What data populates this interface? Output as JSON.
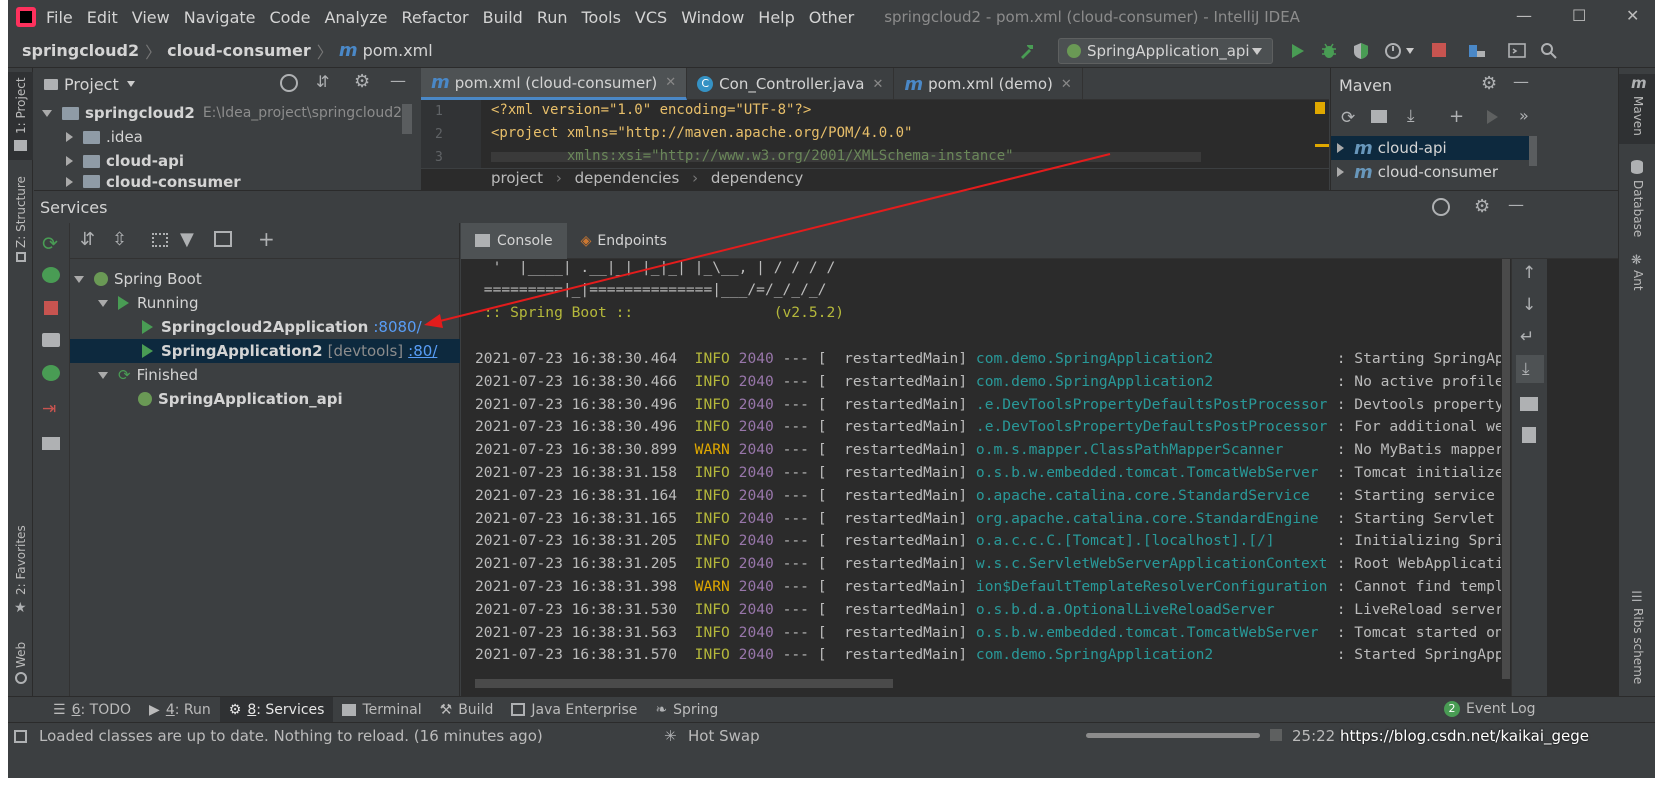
{
  "window": {
    "menu": [
      "File",
      "Edit",
      "View",
      "Navigate",
      "Code",
      "Analyze",
      "Refactor",
      "Build",
      "Run",
      "Tools",
      "VCS",
      "Window",
      "Help",
      "Other"
    ],
    "title": "springcloud2 - pom.xml (cloud-consumer) - IntelliJ IDEA"
  },
  "navbar": {
    "crumbs": [
      "springcloud2",
      "cloud-consumer",
      "pom.xml"
    ],
    "run_config": "SpringApplication_api"
  },
  "left_stripe": {
    "project": "1: Project",
    "structure": "Z: Structure",
    "favorites": "2: Favorites",
    "web": "Web"
  },
  "right_stripe": {
    "maven": "Maven",
    "database": "Database",
    "ant": "Ant",
    "ribs": "Ribs scheme"
  },
  "project": {
    "title": "Project",
    "root_name": "springcloud2",
    "root_path": "E:\\Idea_project\\springcloud2",
    "items": [
      ".idea",
      "cloud-api",
      "cloud-consumer"
    ]
  },
  "editor": {
    "tabs": [
      "pom.xml (cloud-consumer)",
      "Con_Controller.java",
      "pom.xml (demo)"
    ],
    "line_numbers": [
      "1",
      "2",
      "3"
    ],
    "lines": [
      "<?xml version=\"1.0\" encoding=\"UTF-8\"?>",
      "<project xmlns=\"http://maven.apache.org/POM/4.0.0\"",
      "         xmlns:xsi=\"http://www.w3.org/2001/XMLSchema-instance\""
    ],
    "breadcrumbs": [
      "project",
      "dependencies",
      "dependency"
    ]
  },
  "maven": {
    "title": "Maven",
    "items": [
      "cloud-api",
      "cloud-consumer"
    ]
  },
  "services": {
    "title": "Services",
    "tree": {
      "spring_boot": "Spring Boot",
      "running": "Running",
      "app1": "Springcloud2Application",
      "app1_port": ":8080/",
      "app2": "SpringApplication2",
      "app2_devtools": "[devtools]",
      "app2_port": ":80/",
      "finished": "Finished",
      "app3": "SpringApplication_api"
    },
    "console_tabs": [
      "Console",
      "Endpoints"
    ],
    "banner": [
      "  '  |____| .__|_| |_|_| |_\\__, | / / / /",
      " =========|_|==============|___/=/_/_/_/",
      " :: Spring Boot ::                (v2.5.2)"
    ],
    "log": [
      {
        "ts": "2021-07-23 16:38:30.464",
        "level": "INFO",
        "pid": "2040",
        "thread": "restartedMain",
        "logger": "com.demo.SpringApplication2",
        "msg": "Starting SpringApplic"
      },
      {
        "ts": "2021-07-23 16:38:30.466",
        "level": "INFO",
        "pid": "2040",
        "thread": "restartedMain",
        "logger": "com.demo.SpringApplication2",
        "msg": "No active profile set"
      },
      {
        "ts": "2021-07-23 16:38:30.496",
        "level": "INFO",
        "pid": "2040",
        "thread": "restartedMain",
        "logger": ".e.DevToolsPropertyDefaultsPostProcessor",
        "msg": "Devtools property de"
      },
      {
        "ts": "2021-07-23 16:38:30.496",
        "level": "INFO",
        "pid": "2040",
        "thread": "restartedMain",
        "logger": ".e.DevToolsPropertyDefaultsPostProcessor",
        "msg": "For additional web re"
      },
      {
        "ts": "2021-07-23 16:38:30.899",
        "level": "WARN",
        "pid": "2040",
        "thread": "restartedMain",
        "logger": "o.m.s.mapper.ClassPathMapperScanner",
        "msg": "No MyBatis mapper was"
      },
      {
        "ts": "2021-07-23 16:38:31.158",
        "level": "INFO",
        "pid": "2040",
        "thread": "restartedMain",
        "logger": "o.s.b.w.embedded.tomcat.TomcatWebServer",
        "msg": "Tomcat initialized wi"
      },
      {
        "ts": "2021-07-23 16:38:31.164",
        "level": "INFO",
        "pid": "2040",
        "thread": "restartedMain",
        "logger": "o.apache.catalina.core.StandardService",
        "msg": "Starting service [Tom"
      },
      {
        "ts": "2021-07-23 16:38:31.165",
        "level": "INFO",
        "pid": "2040",
        "thread": "restartedMain",
        "logger": "org.apache.catalina.core.StandardEngine",
        "msg": "Starting Servlet engi"
      },
      {
        "ts": "2021-07-23 16:38:31.205",
        "level": "INFO",
        "pid": "2040",
        "thread": "restartedMain",
        "logger": "o.a.c.c.C.[Tomcat].[localhost].[/]",
        "msg": "Initializing Spring e"
      },
      {
        "ts": "2021-07-23 16:38:31.205",
        "level": "INFO",
        "pid": "2040",
        "thread": "restartedMain",
        "logger": "w.s.c.ServletWebServerApplicationContext",
        "msg": "Root WebApplicationCo"
      },
      {
        "ts": "2021-07-23 16:38:31.398",
        "level": "WARN",
        "pid": "2040",
        "thread": "restartedMain",
        "logger": "ion$DefaultTemplateResolverConfiguration",
        "msg": "Cannot find template"
      },
      {
        "ts": "2021-07-23 16:38:31.530",
        "level": "INFO",
        "pid": "2040",
        "thread": "restartedMain",
        "logger": "o.s.b.d.a.OptionalLiveReloadServer",
        "msg": "LiveReload server is"
      },
      {
        "ts": "2021-07-23 16:38:31.563",
        "level": "INFO",
        "pid": "2040",
        "thread": "restartedMain",
        "logger": "o.s.b.w.embedded.tomcat.TomcatWebServer",
        "msg": "Tomcat started on por"
      },
      {
        "ts": "2021-07-23 16:38:31.570",
        "level": "INFO",
        "pid": "2040",
        "thread": "restartedMain",
        "logger": "com.demo.SpringApplication2",
        "msg": "Started SpringApplica"
      }
    ]
  },
  "bottom_tabs": [
    {
      "num": "6",
      "label": "TODO"
    },
    {
      "num": "4",
      "label": "Run"
    },
    {
      "num": "8",
      "label": "Services"
    },
    {
      "num": "",
      "label": "Terminal"
    },
    {
      "num": "",
      "label": "Build"
    },
    {
      "num": "",
      "label": "Java Enterprise"
    },
    {
      "num": "",
      "label": "Spring"
    }
  ],
  "event_log": {
    "badge": "2",
    "label": "Event Log"
  },
  "status": {
    "message": "Loaded classes are up to date. Nothing to reload. (16 minutes ago)",
    "hot_swap": "Hot Swap",
    "position": "25:22",
    "watermark": "https://blog.csdn.net/kaikai_gege"
  },
  "colors": {
    "accent": "#4a88c7",
    "run_green": "#499c54",
    "stop_red": "#c75450",
    "annotation_arrow": "#e31c1c"
  }
}
